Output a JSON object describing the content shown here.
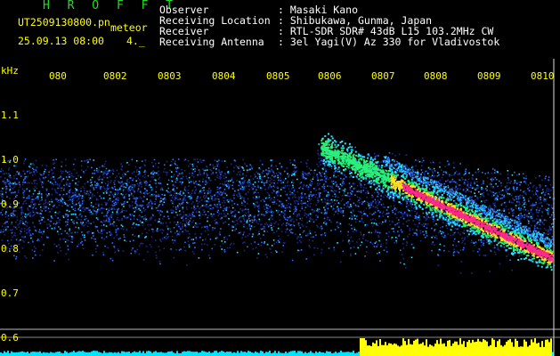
{
  "header": {
    "program_title": "H R O F F T",
    "filename": "UT2509130800.pn",
    "file_tag": "meteor",
    "datetime": "25.09.13 08:00",
    "frame_indicator": "4._",
    "info_labels": [
      "Observer",
      "Receiving Location",
      "Receiver",
      "Receiving Antenna"
    ],
    "info_values": [
      ": Masaki Kano",
      ": Shibukawa, Gunma, Japan",
      ": RTL-SDR SDR# 43dB L15 103.2MHz CW",
      ": 3el Yagi(V) Az 330 for Vladivostok"
    ]
  },
  "axis": {
    "unit": "kHz",
    "y_labels": [
      "1.1",
      "1.0",
      "0.9",
      "0.8",
      "0.7",
      "0.6"
    ],
    "x_labels": [
      "080",
      "080",
      "080",
      "080",
      "080",
      "080",
      "080",
      "080",
      "080",
      "0810"
    ],
    "x_suffixes": [
      "",
      "2",
      "3",
      "4",
      "5",
      "6",
      "7",
      "8",
      "9",
      ""
    ]
  },
  "colors": {
    "background": "#000000",
    "title": "#22dd22",
    "labels": "#ffff00",
    "noise_low": "#1a2a8a",
    "noise_mid": "#2f6fff",
    "noise_high": "#27e0ff",
    "echo_core": "#ff2a8a",
    "echo_mid": "#ffe020",
    "echo_edge": "#29f07a",
    "baseline_power": "#00e5ff",
    "echo_power": "#ffff00"
  }
}
